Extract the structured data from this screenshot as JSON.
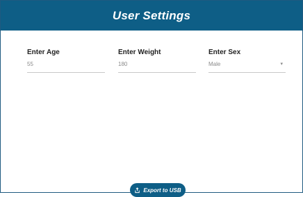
{
  "header": {
    "title": "User Settings"
  },
  "fields": [
    {
      "label": "Enter Age",
      "value": "55"
    },
    {
      "label": "Enter Weight",
      "value": "180"
    },
    {
      "label": "Enter Sex",
      "value": "Male",
      "caret": "▾"
    }
  ],
  "export_button": {
    "label": "Export to USB",
    "icon": "export-icon"
  },
  "colors": {
    "header_bg": "#0e5e86",
    "button_bg": "#0e5e86",
    "label": "#222222",
    "value": "#8a8a8a"
  }
}
